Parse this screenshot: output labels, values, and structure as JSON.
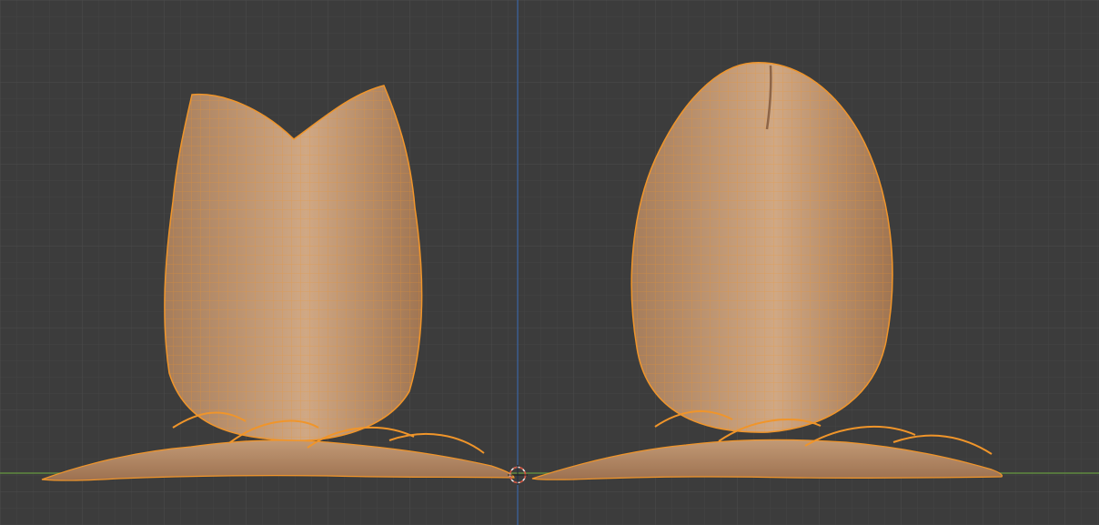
{
  "viewport": {
    "background_color": "#3c3c3c",
    "grid": true,
    "grid_minor_color": "#444444",
    "grid_major_color": "#4b4b4b"
  },
  "axes": {
    "x_axis_color": "#5f8a3f",
    "z_axis_color": "#3b5d8e"
  },
  "objects": [
    {
      "id": "egg-open",
      "state": "selected",
      "shape": "opened-egg"
    },
    {
      "id": "egg-closed",
      "state": "selected",
      "shape": "closed-egg"
    }
  ],
  "overlay": {
    "show_wireframe": true,
    "wire_color": "#f0952a",
    "surface_color": "#c59a72"
  },
  "origin": {
    "icon": "3d-cursor-icon"
  }
}
